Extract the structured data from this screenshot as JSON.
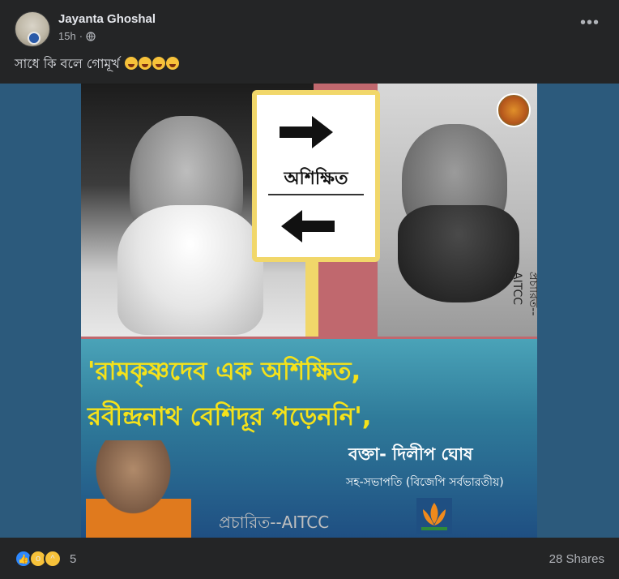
{
  "post": {
    "author": "Jayanta Ghoshal",
    "time": "15h",
    "privacy_icon": "globe-icon",
    "caption": "সাধে কি বলে গোমূর্খ",
    "caption_emojis": [
      "squinting-face-with-tongue",
      "squinting-face-with-tongue",
      "squinting-face-with-tongue",
      "squinting-face-with-tongue"
    ],
    "more_label": "•••"
  },
  "image": {
    "sign_text": "অশিক্ষিত",
    "side_watermark": "প্রচারিত--AITCC",
    "quote_line1": "'রামকৃষ্ণদেব এক অশিক্ষিত,",
    "quote_line2": "রবীন্দ্রনাথ বেশিদূর পড়েননি',",
    "speaker": "বক্তা- দিলীপ ঘোষ",
    "role": "সহ-সভাপতি (বিজেপি সর্বভারতীয়)",
    "source": "প্রচারিত--AITCC",
    "colors": {
      "frame": "#c0686e",
      "sign_border": "#f1d76a",
      "quote": "#f5e21a"
    }
  },
  "footer": {
    "reaction_icons": [
      "like-icon",
      "wow-icon",
      "haha-icon"
    ],
    "reaction_count": "5",
    "shares": "28 Shares"
  }
}
